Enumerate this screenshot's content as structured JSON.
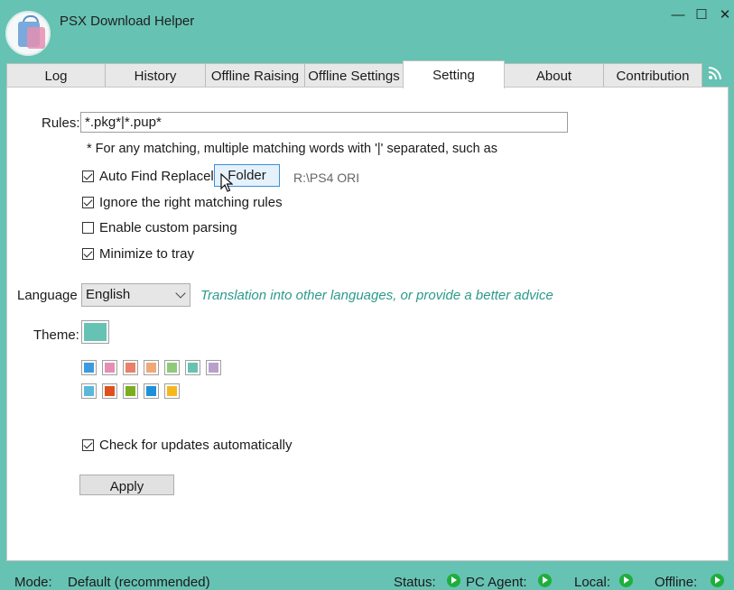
{
  "window": {
    "title": "PSX Download Helper",
    "controls": {
      "minimize": "—",
      "maximize": "☐",
      "close": "✕"
    }
  },
  "tabs": [
    {
      "label": "Log",
      "active": false
    },
    {
      "label": "History",
      "active": false
    },
    {
      "label": "Offline Raising",
      "active": false
    },
    {
      "label": "Offline Settings",
      "active": false
    },
    {
      "label": "Setting",
      "active": true
    },
    {
      "label": "About",
      "active": false
    },
    {
      "label": "Contribution",
      "active": false
    }
  ],
  "settings": {
    "rules_label": "Rules:",
    "rules_value": "*.pkg*|*.pup*",
    "rules_hint": "* For any matching, multiple matching words with '|' separated, such as",
    "auto_find_label": "Auto Find Replacel",
    "auto_find_checked": true,
    "folder_button": "Folder",
    "folder_path": "R:\\PS4 ORI",
    "ignore_right_label": "Ignore the right matching rules",
    "ignore_right_checked": true,
    "custom_parsing_label": "Enable custom parsing",
    "custom_parsing_checked": false,
    "minimize_tray_label": "Minimize to tray",
    "minimize_tray_checked": true,
    "language_label": "Language",
    "language_value": "English",
    "language_link": "Translation into other languages, or provide a better advice",
    "theme_label": "Theme:",
    "theme_current": "#66c2b2",
    "theme_colors_row1": [
      "#3c9be0",
      "#e58fb2",
      "#e8806a",
      "#f0a878",
      "#8fca7a",
      "#66c2b2",
      "#b9a0cc"
    ],
    "theme_colors_row2": [
      "#5ab8d8",
      "#e0501e",
      "#7aae1e",
      "#1e90d8",
      "#f4b81c"
    ],
    "auto_update_label": "Check for updates automatically",
    "auto_update_checked": true,
    "apply_button": "Apply"
  },
  "status": {
    "mode_label": "Mode:",
    "mode_value": "Default (recommended)",
    "status_label": "Status:",
    "pc_agent_label": "PC Agent:",
    "local_label": "Local:",
    "offline_label": "Offline:",
    "indicator_color": "#1fae3d"
  }
}
